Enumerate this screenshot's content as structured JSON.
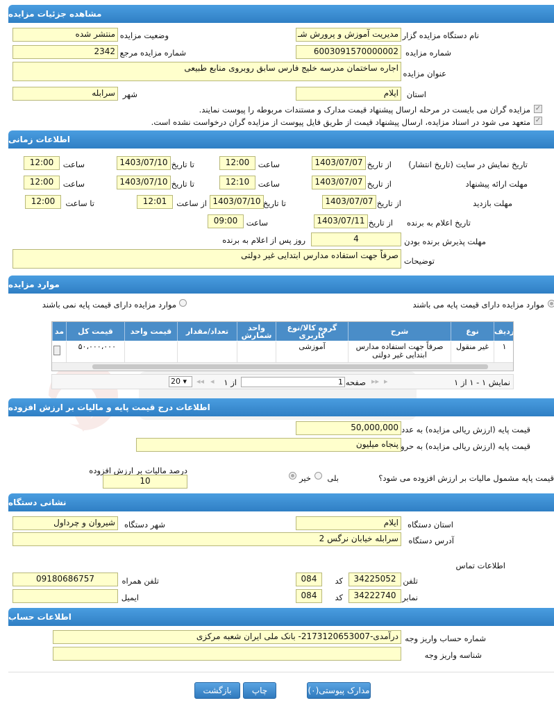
{
  "sections": {
    "details": "مشاهده جزئیات مزایده",
    "timing": "اطلاعات زمانی",
    "items": "موارد مزایده",
    "price": "اطلاعات درج قیمت پایه و مالیات بر ارزش افزوده",
    "address": "نشانی دستگاه",
    "account": "اطلاعات حساب"
  },
  "details": {
    "org_label": "نام دستگاه مزایده گزار",
    "org_value": "مدیریت آموزش و پرورش شـ",
    "status_label": "وضعیت مزایده",
    "status_value": "منتشر شده",
    "number_label": "شماره مزایده",
    "number_value": "6003091570000002",
    "ref_label": "شماره مزایده مرجع",
    "ref_value": "2342",
    "title_label": "عنوان مزایده",
    "title_value": "اجاره ساختمان مدرسه خلیج فارس سابق روبروی منابع طبیعی",
    "province_label": "استان",
    "province_value": "ایلام",
    "city_label": "شهر",
    "city_value": "سرابله",
    "note1": "مزایده گران می بایست در مرحله ارسال پیشنهاد قیمت مدارک و مستندات مربوطه را پیوست نمایند.",
    "note2": "متعهد می شود در اسناد مزایده، ارسال پیشنهاد قیمت از طریق فایل پیوست از مزایده گران درخواست نشده است."
  },
  "timing": {
    "display_label": "تاریخ نمایش در سایت (تاریخ انتشار)",
    "from_date_label": "از تاریخ",
    "to_date_label": "تا تاریخ",
    "time_label": "ساعت",
    "from_time_label": "از ساعت",
    "to_time_label": "تا ساعت",
    "display_from_date": "1403/07/07",
    "display_from_time": "12:00",
    "display_to_date": "1403/07/10",
    "display_to_time": "12:00",
    "offer_label": "مهلت ارائه پیشنهاد",
    "offer_from_date": "1403/07/07",
    "offer_from_time": "12:10",
    "offer_to_date": "1403/07/10",
    "offer_to_time": "12:00",
    "visit_label": "مهلت بازدید",
    "visit_from_date": "1403/07/07",
    "visit_to_date": "1403/07/10",
    "visit_from_time": "12:01",
    "visit_to_time": "12:00",
    "winner_label": "تاریخ اعلام به برنده",
    "winner_date": "1403/07/11",
    "winner_time": "09:00",
    "accept_label": "مهلت پذیرش برنده بودن",
    "accept_value": "4",
    "accept_suffix": "روز پس از اعلام به برنده",
    "desc_label": "توضیحات",
    "desc_value": "صرفاً جهت استفاده مدارس ابتدایی غیر دولتی"
  },
  "items": {
    "radio_with": "موارد مزایده دارای قیمت پایه می باشند",
    "radio_without": "موارد مزایده دارای قیمت پایه نمی باشند",
    "columns": [
      "ردیف",
      "نوع",
      "شرح",
      "گروه کالا/نوع کاربری",
      "واحد شمارش",
      "تعداد/مقدار",
      "قیمت واحد",
      "قیمت کل",
      "مد"
    ],
    "rows": [
      {
        "row": "۱",
        "type": "غیر منقول",
        "desc": "صرفاً جهت استفاده مدارس ابتدایی غیر دولتی",
        "group": "آموزشی",
        "unit": "",
        "qty": "",
        "unit_price": "",
        "total": "۵۰،۰۰۰،۰۰۰"
      }
    ],
    "pager": {
      "summary": "نمایش ۱ - ۱ از ۱",
      "page_label": "صفحه",
      "page_value": "1",
      "of_label": "از ۱",
      "page_size": "20"
    }
  },
  "price": {
    "base_num_label": "قیمت پایه (ارزش ریالی مزایده) به عدد",
    "base_num_value": "50,000,000",
    "base_word_label": "قیمت پایه (ارزش ریالی مزایده) به حروف",
    "base_word_value": "پنجاه میلیون",
    "vat_question": "قیمت پایه مشمول مالیات بر ارزش افزوده می شود؟",
    "yes": "بلی",
    "no": "خیر",
    "vat_percent_label": "درصد مالیات بر ارزش افزوده",
    "vat_percent_value": "10"
  },
  "address": {
    "province_label": "استان دستگاه",
    "province_value": "ایلام",
    "city_label": "شهر دستگاه",
    "city_value": "شیروان و چرداول",
    "addr_label": "آدرس دستگاه",
    "addr_value": "سرابله خیابان نرگس 2",
    "contact_label": "اطلاعات تماس",
    "phone_label": "تلفن",
    "phone_value": "34225052",
    "code_label": "کد",
    "phone_code": "084",
    "mobile_label": "تلفن همراه",
    "mobile_value": "09180686757",
    "fax_label": "نمابر",
    "fax_value": "34222740",
    "fax_code": "084",
    "email_label": "ایمیل",
    "email_value": ""
  },
  "account": {
    "acc_label": "شماره حساب واریز وجه",
    "acc_value": "درآمدی-2173120653007- بانک ملی ایران شعبه مرکزی",
    "id_label": "شناسه واریز وجه",
    "id_value": ""
  },
  "buttons": {
    "docs": "مدارک پیوستی(۰)",
    "print": "چاپ",
    "back": "بازگشت"
  },
  "colors": {
    "header_bar": "#3a8ed0",
    "field_bg": "#ffffcc",
    "grid_head": "#4a8dc8"
  }
}
